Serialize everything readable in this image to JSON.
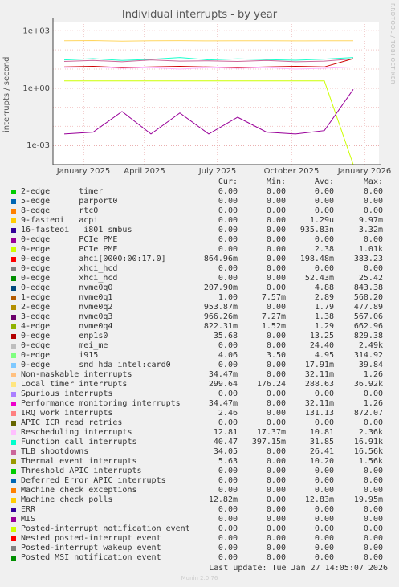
{
  "chart_data": {
    "type": "line",
    "title": "Individual interrupts - by year",
    "ylabel": "interrupts / second",
    "yscale": "log",
    "ylim": [
      0.0001,
      3000
    ],
    "y_ticks": [
      {
        "value": 1000,
        "label": "1e+03"
      },
      {
        "value": 1,
        "label": "1e+00"
      },
      {
        "value": 0.001,
        "label": "1e-03"
      }
    ],
    "x_ticks": [
      "January 2025",
      "April 2025",
      "July 2025",
      "October 2025",
      "January 2026"
    ],
    "grid": true,
    "series": [
      {
        "name": "Local timer interrupts",
        "color": "#FFD660",
        "values": [
          300,
          310,
          290,
          300,
          305,
          298,
          302,
          300,
          296,
          300,
          299
        ]
      },
      {
        "name": "Rescheduling interrupts",
        "color": "#FFB4FF",
        "values": [
          12,
          13,
          11,
          12,
          10,
          12,
          11,
          12,
          10,
          11,
          12.8
        ]
      },
      {
        "name": "Function call interrupts",
        "color": "#1AFFCC",
        "values": [
          30,
          35,
          28,
          32,
          40,
          30,
          34,
          31,
          29,
          33,
          40
        ]
      },
      {
        "name": "TLB shootdowns",
        "color": "#CC6699",
        "values": [
          25,
          28,
          24,
          30,
          26,
          27,
          25,
          28,
          24,
          26,
          34
        ]
      },
      {
        "name": "ahci[0000:00:17.0]",
        "color": "#990099",
        "values": [
          0.004,
          0.005,
          0.06,
          0.004,
          0.05,
          0.004,
          0.03,
          0.005,
          0.004,
          0.006,
          0.86
        ]
      },
      {
        "name": "PCIe PME",
        "color": "#CCFF00",
        "values": [
          2.4,
          2.4,
          2.4,
          2.4,
          2.4,
          2.4,
          2.4,
          2.4,
          2.4,
          2.4,
          0.0
        ]
      },
      {
        "name": "enp1s0",
        "color": "#CC0000",
        "values": [
          13,
          14,
          12,
          13,
          14,
          13,
          12,
          13,
          14,
          13,
          35
        ]
      }
    ],
    "columns": [
      "Cur:",
      "Min:",
      "Avg:",
      "Max:"
    ],
    "legend": [
      {
        "label": "2-edge      timer",
        "color": "#00CC00",
        "cur": "0.00",
        "min": "0.00",
        "avg": "0.00",
        "max": "0.00"
      },
      {
        "label": "5-edge      parport0",
        "color": "#0066B3",
        "cur": "0.00",
        "min": "0.00",
        "avg": "0.00",
        "max": "0.00"
      },
      {
        "label": "8-edge      rtc0",
        "color": "#FF8000",
        "cur": "0.00",
        "min": "0.00",
        "avg": "0.00",
        "max": "0.00"
      },
      {
        "label": "9-fasteoi   acpi",
        "color": "#FFCC00",
        "cur": "0.00",
        "min": "0.00",
        "avg": "1.29u",
        "max": "9.97m"
      },
      {
        "label": "16-fasteoi   i801_smbus",
        "color": "#330099",
        "cur": "0.00",
        "min": "0.00",
        "avg": "935.83n",
        "max": "3.32m"
      },
      {
        "label": "0-edge      PCIe PME",
        "color": "#990099",
        "cur": "0.00",
        "min": "0.00",
        "avg": "0.00",
        "max": "0.00"
      },
      {
        "label": "0-edge      PCIe PME",
        "color": "#CCFF00",
        "cur": "0.00",
        "min": "0.00",
        "avg": "2.38",
        "max": "1.01k"
      },
      {
        "label": "0-edge      ahci[0000:00:17.0]",
        "color": "#FF0000",
        "cur": "864.96m",
        "min": "0.00",
        "avg": "198.48m",
        "max": "383.23"
      },
      {
        "label": "0-edge      xhci_hcd",
        "color": "#808080",
        "cur": "0.00",
        "min": "0.00",
        "avg": "0.00",
        "max": "0.00"
      },
      {
        "label": "0-edge      xhci_hcd",
        "color": "#008F00",
        "cur": "0.00",
        "min": "0.00",
        "avg": "52.43m",
        "max": "25.42"
      },
      {
        "label": "0-edge      nvme0q0",
        "color": "#00487D",
        "cur": "207.90m",
        "min": "0.00",
        "avg": "4.88",
        "max": "843.38"
      },
      {
        "label": "1-edge      nvme0q1",
        "color": "#B35A00",
        "cur": "1.00",
        "min": "7.57m",
        "avg": "2.89",
        "max": "568.20"
      },
      {
        "label": "2-edge      nvme0q2",
        "color": "#B38F00",
        "cur": "953.87m",
        "min": "0.00",
        "avg": "1.79",
        "max": "477.89"
      },
      {
        "label": "3-edge      nvme0q3",
        "color": "#6B006B",
        "cur": "966.26m",
        "min": "7.27m",
        "avg": "1.38",
        "max": "567.06"
      },
      {
        "label": "4-edge      nvme0q4",
        "color": "#8FB300",
        "cur": "822.31m",
        "min": "1.52m",
        "avg": "1.29",
        "max": "662.96"
      },
      {
        "label": "0-edge      enp1s0",
        "color": "#B30000",
        "cur": "35.68",
        "min": "0.00",
        "avg": "13.25",
        "max": "829.38"
      },
      {
        "label": "0-edge      mei_me",
        "color": "#BEBEBE",
        "cur": "0.00",
        "min": "0.00",
        "avg": "24.40",
        "max": "2.49k"
      },
      {
        "label": "0-edge      i915",
        "color": "#80FF80",
        "cur": "4.06",
        "min": "3.50",
        "avg": "4.95",
        "max": "314.92"
      },
      {
        "label": "0-edge      snd_hda_intel:card0",
        "color": "#80C9FF",
        "cur": "0.00",
        "min": "0.00",
        "avg": "17.91m",
        "max": "39.84"
      },
      {
        "label": "Non-maskable interrupts",
        "color": "#FFC080",
        "cur": "34.47m",
        "min": "0.00",
        "avg": "32.11m",
        "max": "1.26"
      },
      {
        "label": "Local timer interrupts",
        "color": "#FFE680",
        "cur": "299.64",
        "min": "176.24",
        "avg": "288.63",
        "max": "36.92k"
      },
      {
        "label": "Spurious interrupts",
        "color": "#AA80FF",
        "cur": "0.00",
        "min": "0.00",
        "avg": "0.00",
        "max": "0.00"
      },
      {
        "label": "Performance monitoring interrupts",
        "color": "#EE00CC",
        "cur": "34.47m",
        "min": "0.00",
        "avg": "32.11m",
        "max": "1.26"
      },
      {
        "label": "IRQ work interrupts",
        "color": "#FF8080",
        "cur": "2.46",
        "min": "0.00",
        "avg": "131.13",
        "max": "872.07"
      },
      {
        "label": "APIC ICR read retries",
        "color": "#666600",
        "cur": "0.00",
        "min": "0.00",
        "avg": "0.00",
        "max": "0.00"
      },
      {
        "label": "Rescheduling interrupts",
        "color": "#FFBFFF",
        "cur": "12.81",
        "min": "17.37m",
        "avg": "10.81",
        "max": "2.36k"
      },
      {
        "label": "Function call interrupts",
        "color": "#00FFCC",
        "cur": "40.47",
        "min": "397.15m",
        "avg": "31.85",
        "max": "16.91k"
      },
      {
        "label": "TLB shootdowns",
        "color": "#CC6699",
        "cur": "34.05",
        "min": "0.00",
        "avg": "26.41",
        "max": "16.56k"
      },
      {
        "label": "Thermal event interrupts",
        "color": "#999900",
        "cur": "5.63",
        "min": "0.00",
        "avg": "10.20",
        "max": "1.56k"
      },
      {
        "label": "Threshold APIC interrupts",
        "color": "#00CC00",
        "cur": "0.00",
        "min": "0.00",
        "avg": "0.00",
        "max": "0.00"
      },
      {
        "label": "Deferred Error APIC interrupts",
        "color": "#0066B3",
        "cur": "0.00",
        "min": "0.00",
        "avg": "0.00",
        "max": "0.00"
      },
      {
        "label": "Machine check exceptions",
        "color": "#FF8000",
        "cur": "0.00",
        "min": "0.00",
        "avg": "0.00",
        "max": "0.00"
      },
      {
        "label": "Machine check polls",
        "color": "#FFCC00",
        "cur": "12.82m",
        "min": "0.00",
        "avg": "12.83m",
        "max": "19.95m"
      },
      {
        "label": "ERR",
        "color": "#330099",
        "cur": "0.00",
        "min": "0.00",
        "avg": "0.00",
        "max": "0.00"
      },
      {
        "label": "MIS",
        "color": "#990099",
        "cur": "0.00",
        "min": "0.00",
        "avg": "0.00",
        "max": "0.00"
      },
      {
        "label": "Posted-interrupt notification event",
        "color": "#CCFF00",
        "cur": "0.00",
        "min": "0.00",
        "avg": "0.00",
        "max": "0.00"
      },
      {
        "label": "Nested posted-interrupt event",
        "color": "#FF0000",
        "cur": "0.00",
        "min": "0.00",
        "avg": "0.00",
        "max": "0.00"
      },
      {
        "label": "Posted-interrupt wakeup event",
        "color": "#808080",
        "cur": "0.00",
        "min": "0.00",
        "avg": "0.00",
        "max": "0.00"
      },
      {
        "label": "Posted MSI notification event",
        "color": "#008F00",
        "cur": "0.00",
        "min": "0.00",
        "avg": "0.00",
        "max": "0.00"
      }
    ]
  },
  "footer": "Last update: Tue Jan 27 14:05:07 2026",
  "watermark": "RRDTOOL / TOBI OETIKER",
  "credit": "Munin 2.0.76"
}
